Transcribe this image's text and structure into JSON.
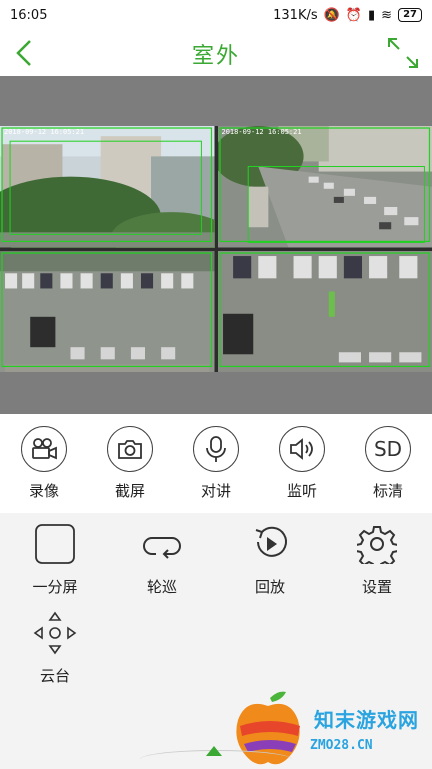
{
  "status": {
    "time": "16:05",
    "speed": "131K/s",
    "battery": "27"
  },
  "header": {
    "title": "室外"
  },
  "cameras": [
    {
      "timestamp": "2018-09-12  16:05:21"
    },
    {
      "timestamp": "2018-09-12  16:05:21"
    },
    {
      "timestamp": ""
    },
    {
      "timestamp": ""
    }
  ],
  "controls": [
    {
      "label": "录像",
      "icon": "video-camera-icon"
    },
    {
      "label": "截屏",
      "icon": "camera-icon"
    },
    {
      "label": "对讲",
      "icon": "microphone-icon"
    },
    {
      "label": "监听",
      "icon": "speaker-icon"
    },
    {
      "label": "标清",
      "icon": "sd-icon",
      "text": "SD"
    }
  ],
  "panel": [
    {
      "label": "一分屏",
      "icon": "single-screen-icon"
    },
    {
      "label": "轮巡",
      "icon": "patrol-icon"
    },
    {
      "label": "回放",
      "icon": "playback-icon"
    },
    {
      "label": "设置",
      "icon": "gear-icon"
    },
    {
      "label": "云台",
      "icon": "ptz-icon"
    }
  ],
  "watermark": {
    "name": "知末游戏网",
    "site": "ZMO28.CN"
  },
  "colors": {
    "accent": "#3aa832",
    "detect": "#22d122"
  }
}
